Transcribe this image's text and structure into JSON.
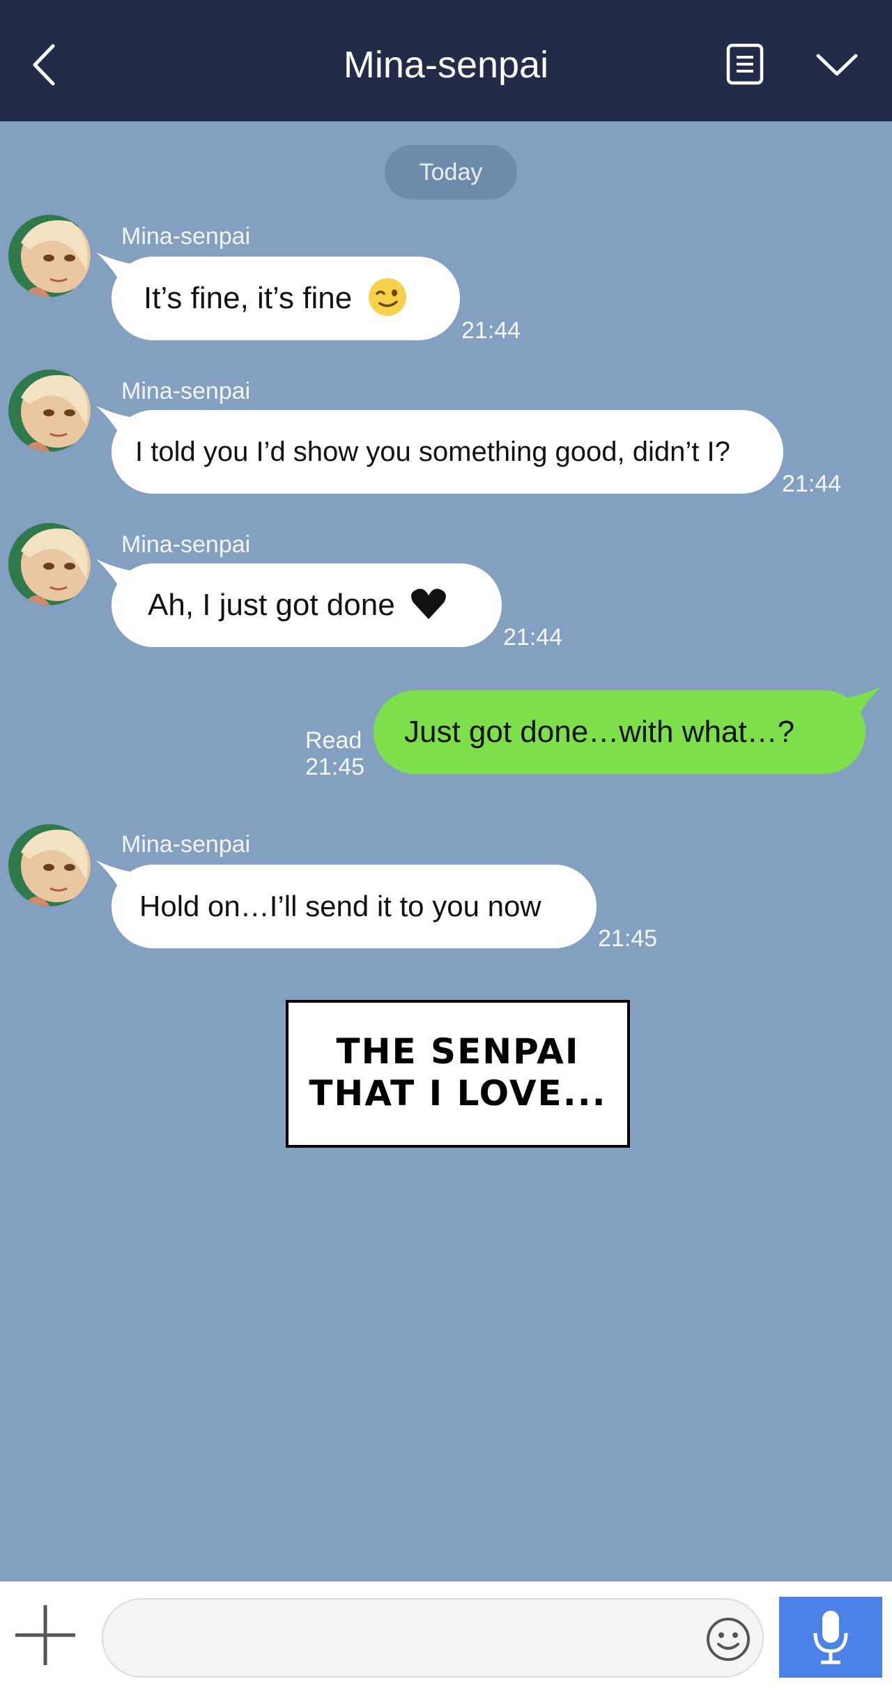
{
  "header": {
    "title": "Mina-senpai"
  },
  "date_separator": "Today",
  "messages": [
    {
      "sender": "Mina-senpai",
      "text": "It’s fine, it’s fine",
      "emoji": "winking-face-icon",
      "time": "21:44"
    },
    {
      "sender": "Mina-senpai",
      "text": "I told you I’d show you something good, didn’t I?",
      "time": "21:44"
    },
    {
      "sender": "Mina-senpai",
      "text": "Ah, I just got done",
      "emoji": "heart-icon",
      "time": "21:44"
    },
    {
      "outgoing": true,
      "text": "Just got done…with what…?",
      "read_label": "Read",
      "time": "21:45"
    },
    {
      "sender": "Mina-senpai",
      "text": "Hold on…I’ll send it to you now",
      "time": "21:45"
    }
  ],
  "caption": {
    "line1": "THE SENPAI",
    "line2": "THAT I LOVE..."
  },
  "composer": {
    "input_value": "",
    "placeholder": ""
  },
  "colors": {
    "header_bg": "#222c48",
    "chat_bg": "#84a0c0",
    "incoming_bubble": "#ffffff",
    "outgoing_bubble": "#7de04a",
    "send_button": "#4a82e8"
  }
}
